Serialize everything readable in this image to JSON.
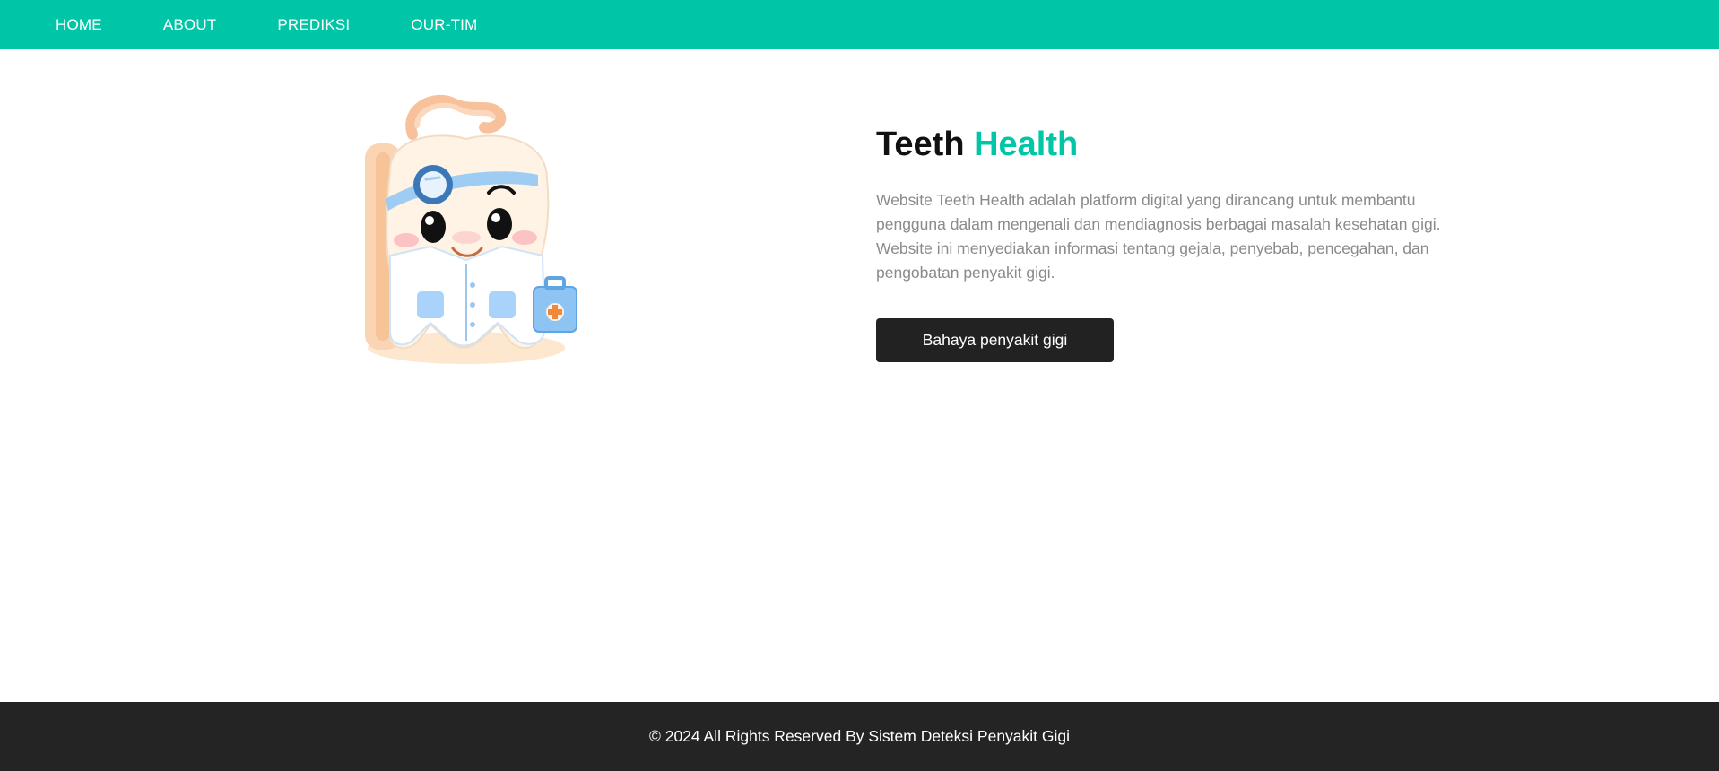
{
  "nav": {
    "items": [
      {
        "label": "HOME"
      },
      {
        "label": "ABOUT"
      },
      {
        "label": "PREDIKSI"
      },
      {
        "label": "OUR-TIM"
      }
    ],
    "background": "#00c6a7"
  },
  "hero": {
    "title_part1": "Teeth",
    "title_part2": "Health",
    "accent_color": "#00c6a7",
    "description": "Website Teeth Health adalah platform digital yang dirancang untuk membantu pengguna dalam mengenali dan mendiagnosis berbagai masalah kesehatan gigi. Website ini menyediakan informasi tentang gejala, penyebab, pencegahan, dan pengobatan penyakit gigi.",
    "button_label": "Bahaya penyakit gigi",
    "illustration": "tooth-doctor-mascot"
  },
  "footer": {
    "text": "© 2024 All Rights Reserved By Sistem Deteksi Penyakit Gigi"
  }
}
